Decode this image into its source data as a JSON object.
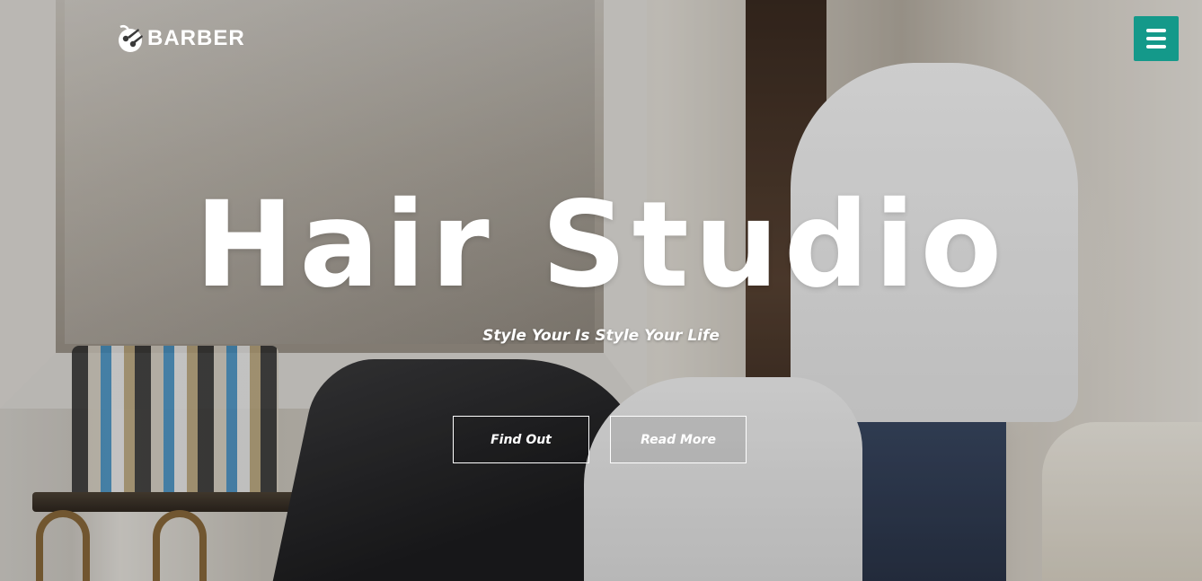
{
  "brand": {
    "name": "BARBER",
    "logo_icon": "barber-logo-icon"
  },
  "nav": {
    "menu_icon": "hamburger-menu-icon",
    "accent_color": "#14998a"
  },
  "hero": {
    "title": "Hair Studio",
    "subtitle": "Style Your Is Style Your Life",
    "buttons": [
      {
        "label": "Find Out"
      },
      {
        "label": "Read More"
      }
    ]
  }
}
